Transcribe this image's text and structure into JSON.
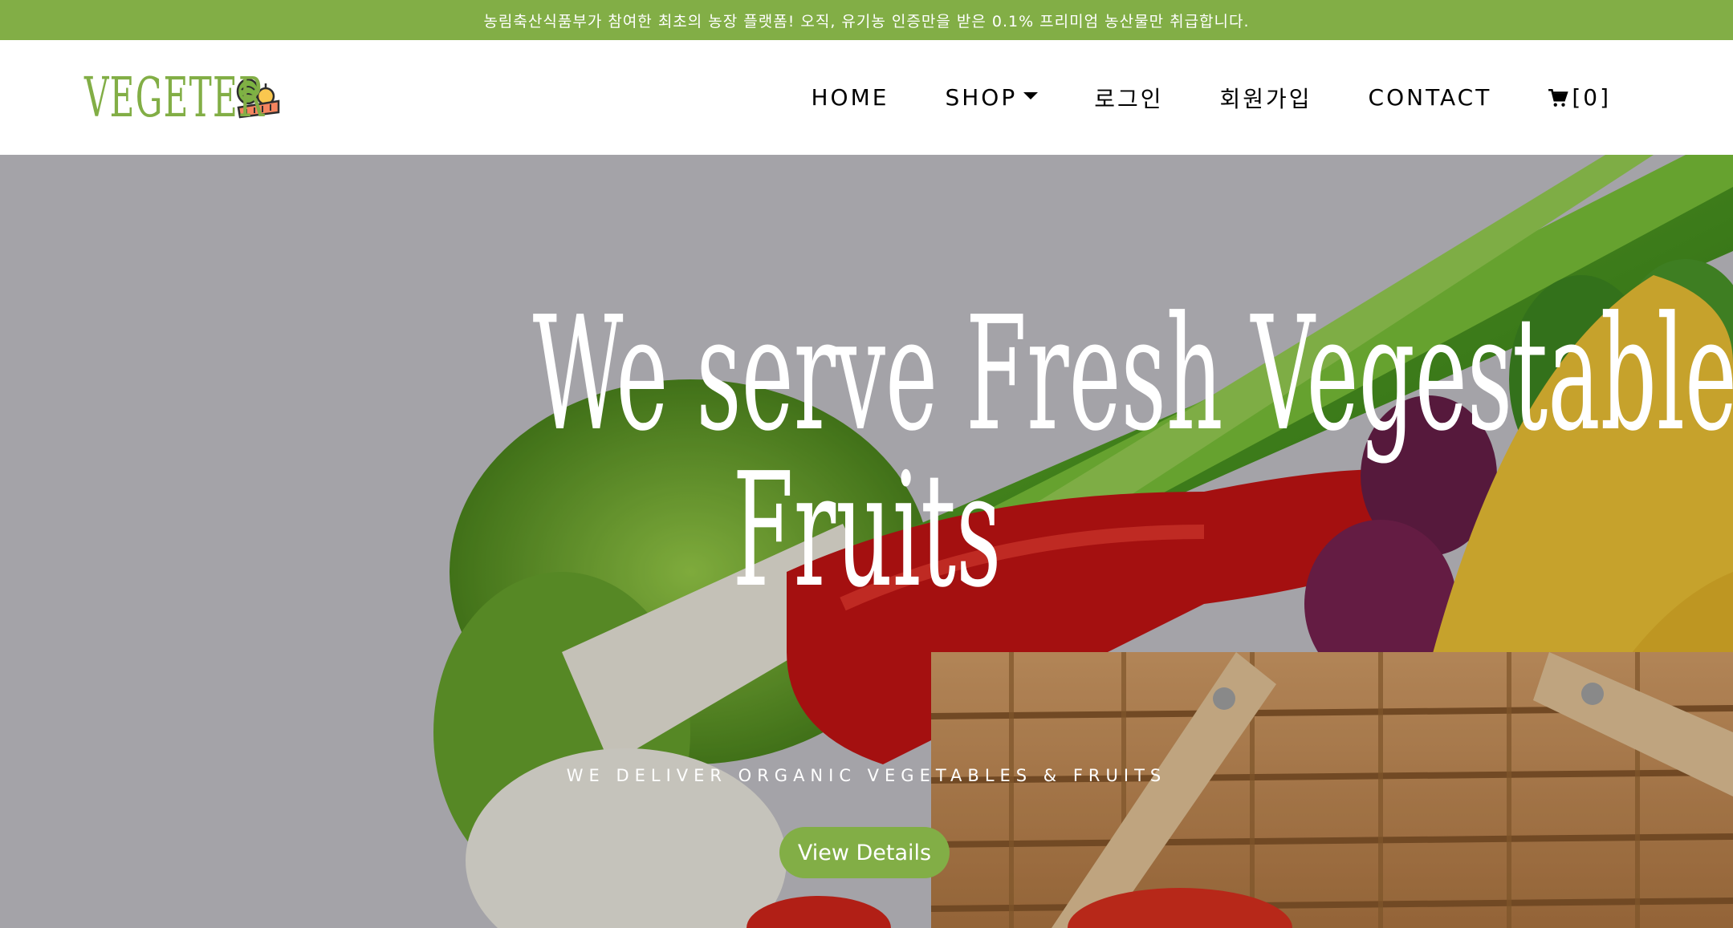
{
  "announcement": "농림축산식품부가 참여한 최초의 농장 플랫폼! 오직, 유기농 인증만을 받은 0.1% 프리미엄 농산물만 취급합니다.",
  "brand": {
    "name": "VEGETER",
    "logo_icon": "vegetables-basket-icon"
  },
  "nav": {
    "home": "HOME",
    "shop": "SHOP",
    "login": "로그인",
    "signup": "회원가입",
    "contact": "CONTACT",
    "cart_label": "[0]",
    "cart_icon": "cart-icon"
  },
  "hero": {
    "title_line1": "We serve Fresh Vegestables &",
    "title_line2": "Fruits",
    "subtitle": "WE DELIVER ORGANIC VEGETABLES & FRUITS",
    "button": "View Details"
  },
  "colors": {
    "accent": "#82ae46",
    "text": "#000000",
    "background": "#ffffff"
  }
}
